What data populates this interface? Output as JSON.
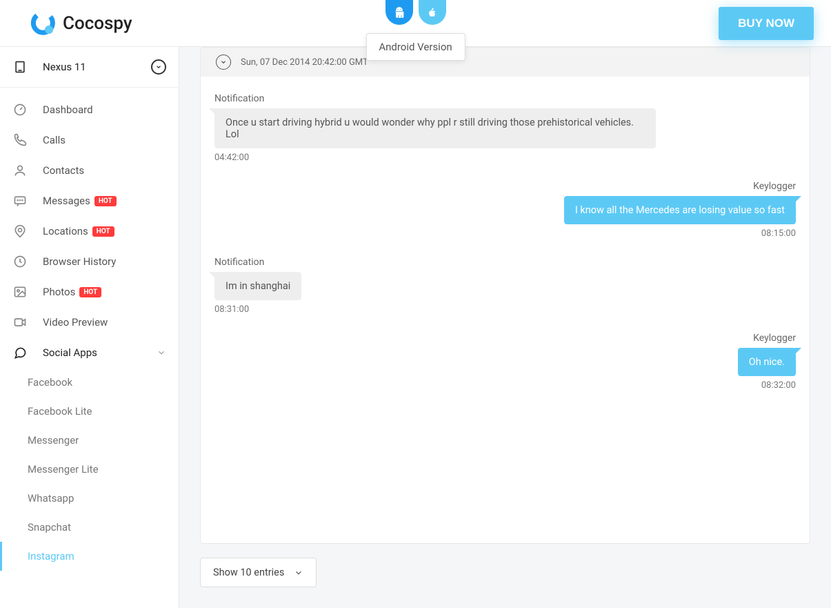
{
  "brand": {
    "name": "Cocospy"
  },
  "header": {
    "tooltip": "Android Version",
    "buy_label": "BUY NOW"
  },
  "device": {
    "name": "Nexus 11"
  },
  "nav": {
    "dashboard": "Dashboard",
    "calls": "Calls",
    "contacts": "Contacts",
    "messages": "Messages",
    "locations": "Locations",
    "browser_history": "Browser History",
    "photos": "Photos",
    "video_preview": "Video Preview",
    "social_apps": "Social Apps",
    "hot_badge": "HOT"
  },
  "social": {
    "facebook": "Facebook",
    "facebook_lite": "Facebook Lite",
    "messenger": "Messenger",
    "messenger_lite": "Messenger Lite",
    "whatsapp": "Whatsapp",
    "snapchat": "Snapchat",
    "instagram": "Instagram"
  },
  "chat": {
    "date_header": "Sun, 07 Dec 2014 20:42:00 GMT",
    "messages": [
      {
        "side": "left",
        "sender": "Notification",
        "text": "Once u start driving hybrid u would wonder why ppl r still driving those prehistorical vehicles. Lol",
        "time": "04:42:00"
      },
      {
        "side": "right",
        "sender": "Keylogger",
        "text": "I know all the Mercedes are losing value so fast",
        "time": "08:15:00"
      },
      {
        "side": "left",
        "sender": "Notification",
        "text": "Im in shanghai",
        "time": "08:31:00"
      },
      {
        "side": "right",
        "sender": "Keylogger",
        "text": "Oh nice.",
        "time": "08:32:00"
      }
    ]
  },
  "pager": {
    "show_entries": "Show 10 entries"
  }
}
